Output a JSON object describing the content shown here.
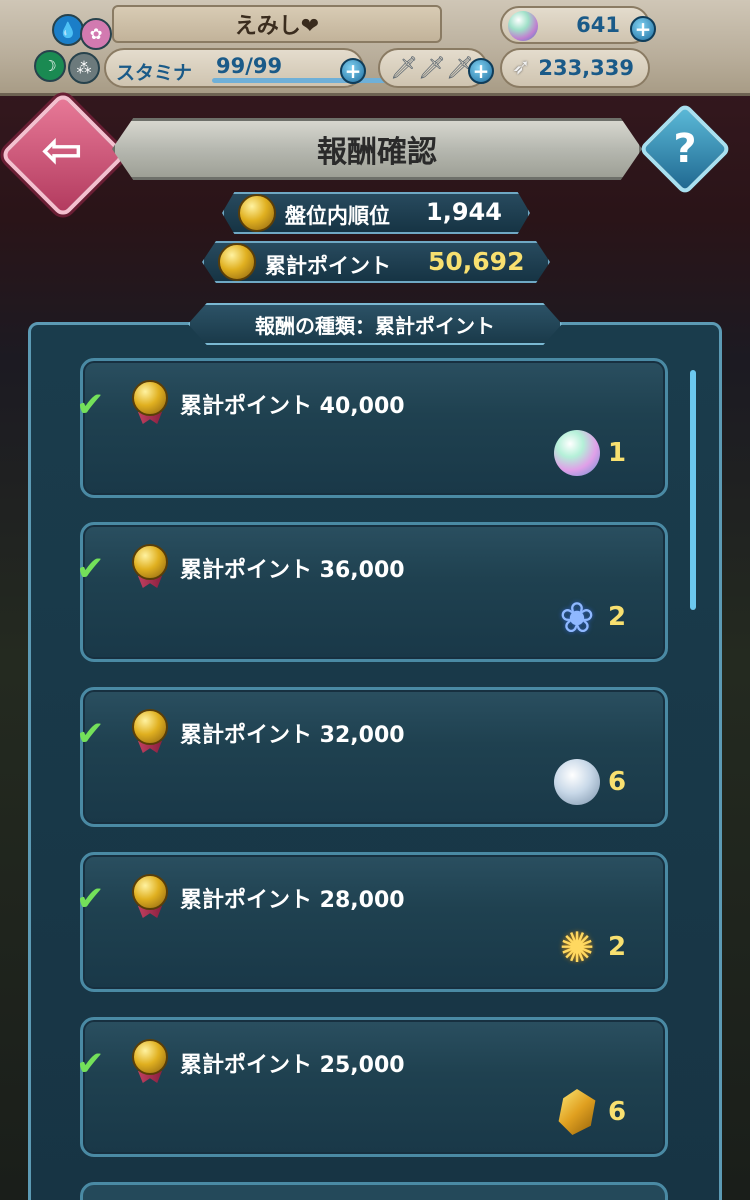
{
  "status": {
    "player_name": "えみし❤",
    "stamina_label": "スタミナ",
    "stamina_value": "99/99",
    "stamina_fill": 1.0,
    "swords": "🗡🗡🗡",
    "orbs": "641",
    "feathers": "233,339"
  },
  "header": {
    "title": "報酬確認",
    "back_icon": "arrow-left-icon",
    "help_label": "?"
  },
  "stats": {
    "rank_label": "盤位内順位",
    "rank_value": "1,944",
    "points_label": "累計ポイント",
    "points_value": "50,692"
  },
  "panel": {
    "tab_label": "報酬の種類：累計ポイント"
  },
  "rewards": [
    {
      "title": "累計ポイント 40,000",
      "icon": "orb-icon",
      "qty": "1",
      "claimed": true
    },
    {
      "title": "累計ポイント 36,000",
      "icon": "blue-flower-icon",
      "qty": "2",
      "claimed": true
    },
    {
      "title": "累計ポイント 32,000",
      "icon": "moon-badge-icon",
      "qty": "6",
      "claimed": true
    },
    {
      "title": "累計ポイント 28,000",
      "icon": "gold-flower-icon",
      "qty": "2",
      "claimed": true
    },
    {
      "title": "累計ポイント 25,000",
      "icon": "gold-gem-icon",
      "qty": "6",
      "claimed": true
    }
  ],
  "colors": {
    "accent_gold": "#f8e070",
    "check_green": "#74e05a",
    "panel_border": "#5c9ab4"
  }
}
